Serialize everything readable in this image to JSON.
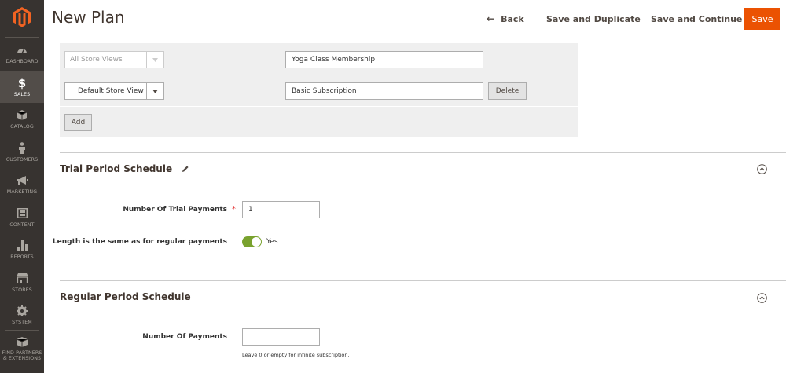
{
  "header": {
    "title": "New Plan",
    "back_label": "Back",
    "save_duplicate_label": "Save and Duplicate",
    "save_continue_label": "Save and Continue",
    "save_label": "Save"
  },
  "sidebar": {
    "items": [
      {
        "label": "Dashboard",
        "icon": "speedometer-icon"
      },
      {
        "label": "Sales",
        "icon": "dollar-icon"
      },
      {
        "label": "Catalog",
        "icon": "cube-icon"
      },
      {
        "label": "Customers",
        "icon": "person-icon"
      },
      {
        "label": "Marketing",
        "icon": "megaphone-icon"
      },
      {
        "label": "Content",
        "icon": "content-icon"
      },
      {
        "label": "Reports",
        "icon": "bar-chart-icon"
      },
      {
        "label": "Stores",
        "icon": "store-icon"
      },
      {
        "label": "System",
        "icon": "gear-icon"
      },
      {
        "label": "Find Partners & Extensions",
        "icon": "box-icon"
      }
    ]
  },
  "store_views": {
    "rows": [
      {
        "store": "All Store Views",
        "value": "Yoga Class Membership",
        "disabled": true
      },
      {
        "store": "Default Store View",
        "value": "Basic Subscription",
        "delete_label": "Delete"
      }
    ],
    "add_label": "Add"
  },
  "trial_section": {
    "title": "Trial Period Schedule",
    "trial_payments_label": "Number Of Trial Payments",
    "trial_payments_value": "1",
    "length_same_label": "Length is the same as for regular payments",
    "toggle_label": "Yes",
    "toggle_on": true
  },
  "regular_section": {
    "title": "Regular Period Schedule",
    "payments_label": "Number Of Payments",
    "payments_value": "",
    "payments_note": "Leave 0 or empty for infinite subscription."
  },
  "colors": {
    "accent": "#eb5202",
    "sidebar_bg": "#373330",
    "sidebar_active": "#524d49",
    "toggle_on": "#79a22e",
    "required": "#e22626"
  }
}
